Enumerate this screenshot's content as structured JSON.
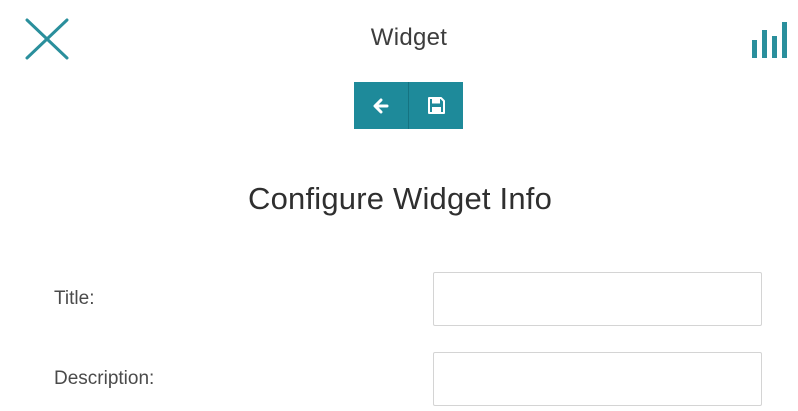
{
  "header": {
    "title": "Widget",
    "close_icon": "close-icon",
    "stats_icon": "bar-chart-icon"
  },
  "toolbar": {
    "back_icon": "arrow-left-icon",
    "save_icon": "save-icon"
  },
  "main": {
    "heading": "Configure Widget Info",
    "fields": [
      {
        "label": "Title:",
        "value": ""
      },
      {
        "label": "Description:",
        "value": ""
      }
    ]
  },
  "colors": {
    "accent": "#1e8a9a",
    "icon_teal": "#2a8f9c"
  }
}
